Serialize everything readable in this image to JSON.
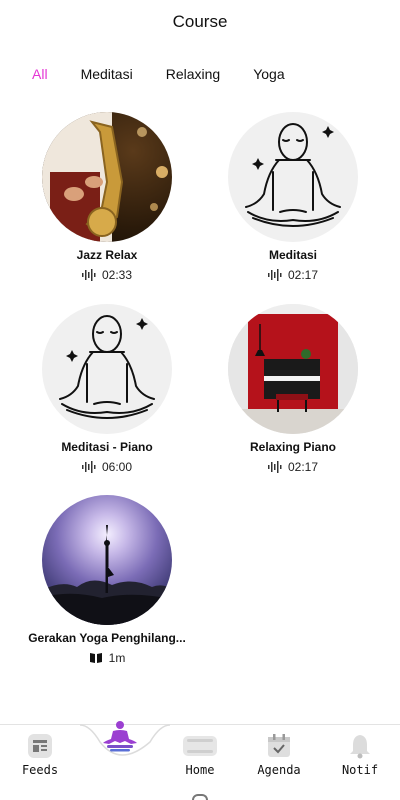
{
  "header": {
    "title": "Course"
  },
  "tabs": [
    {
      "label": "All",
      "active": true
    },
    {
      "label": "Meditasi",
      "active": false
    },
    {
      "label": "Relaxing",
      "active": false
    },
    {
      "label": "Yoga",
      "active": false
    }
  ],
  "courses": [
    {
      "title": "Jazz Relax",
      "meta": "02:33",
      "meta_icon": "audio-wave-icon",
      "image": "saxophone-player"
    },
    {
      "title": "Meditasi",
      "meta": "02:17",
      "meta_icon": "audio-wave-icon",
      "image": "meditation-line-art"
    },
    {
      "title": "Meditasi - Piano",
      "meta": "06:00",
      "meta_icon": "audio-wave-icon",
      "image": "meditation-line-art"
    },
    {
      "title": "Relaxing Piano",
      "meta": "02:17",
      "meta_icon": "audio-wave-icon",
      "image": "piano-room"
    },
    {
      "title": "Gerakan Yoga Penghilang...",
      "meta": "1m",
      "meta_icon": "book-icon",
      "image": "yoga-silhouette"
    }
  ],
  "nav": {
    "feeds": "Feeds",
    "home": "Home",
    "agenda": "Agenda",
    "notif": "Notif"
  },
  "colors": {
    "accent": "#e535d4",
    "meditation_purple": "#9b3fd1"
  }
}
